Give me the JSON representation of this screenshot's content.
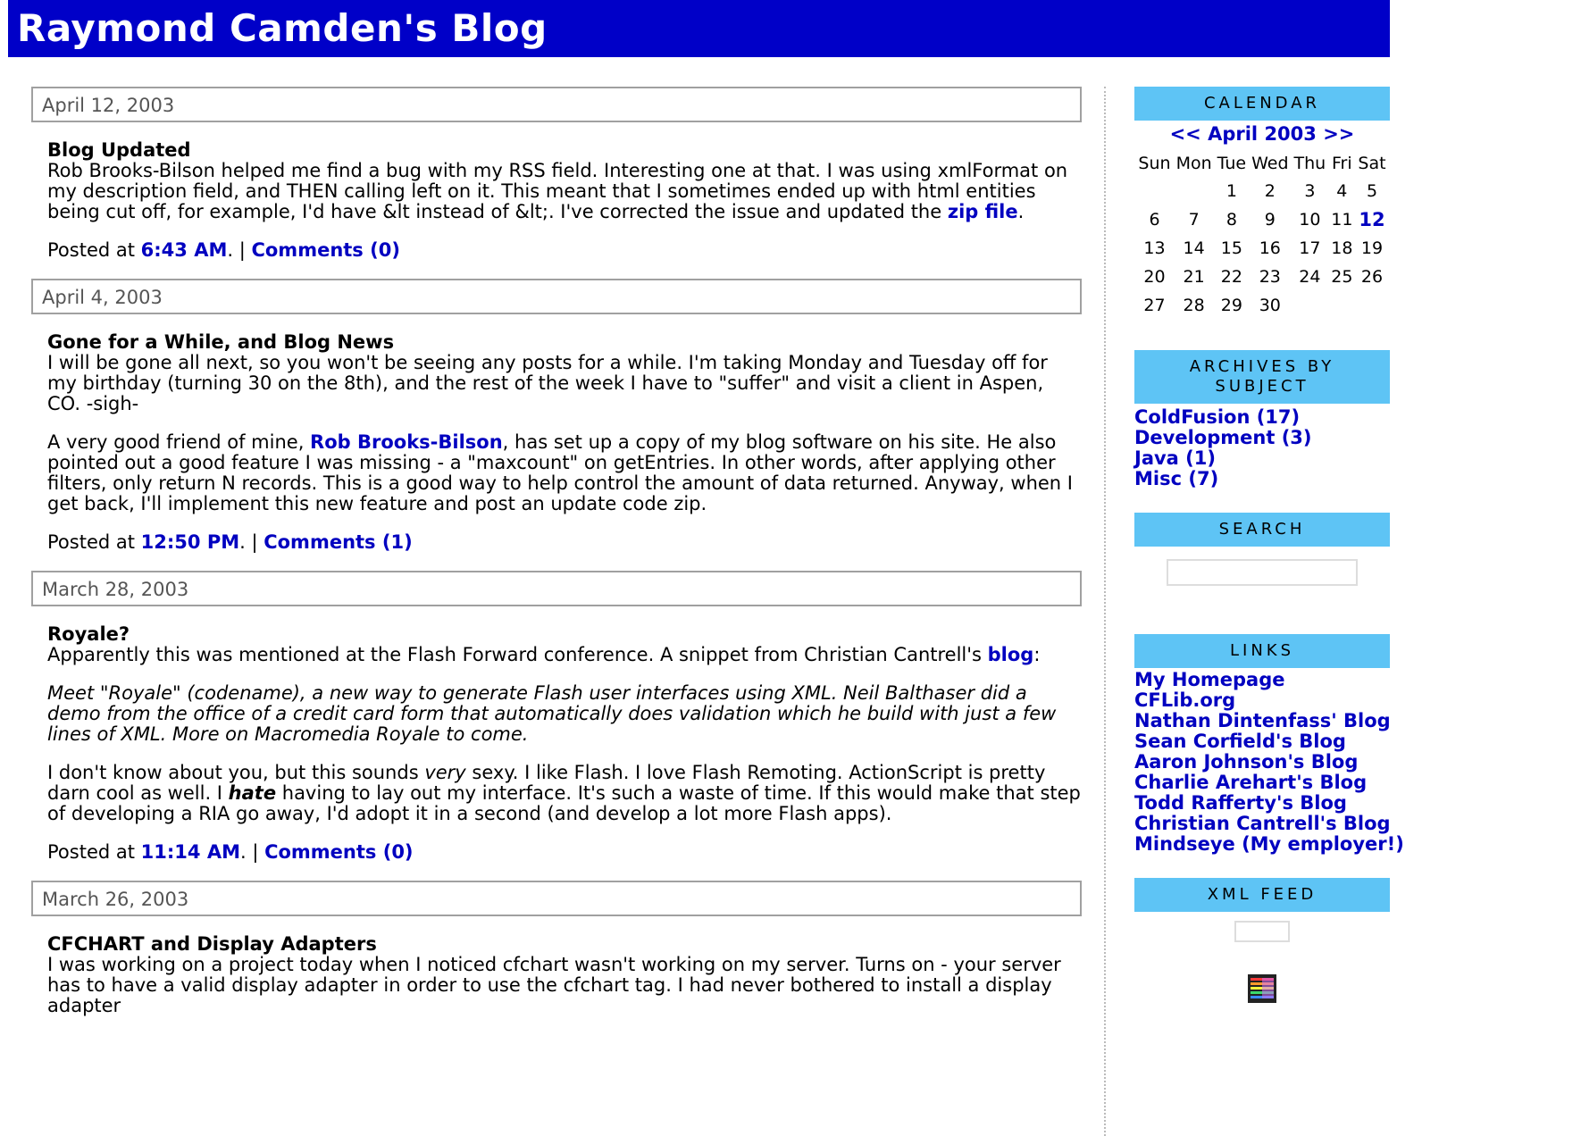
{
  "header": {
    "title": "Raymond Camden's Blog"
  },
  "entries": [
    {
      "date": "April 12, 2003",
      "title": "Blog Updated",
      "body": [
        {
          "segments": [
            {
              "text": "Rob Brooks-Bilson helped me find a bug with my RSS field. Interesting one at that. I was using xmlFormat on my description field, and THEN calling left on it. This meant that I sometimes ended up with html entities being cut off, for example, I'd have &lt instead of &lt;. I've corrected the issue and updated the "
            },
            {
              "text": "zip file",
              "link": true
            },
            {
              "text": "."
            }
          ]
        }
      ],
      "posted_prefix": "Posted at ",
      "time": "6:43 AM",
      "separator": ". | ",
      "comments": "Comments (0)"
    },
    {
      "date": "April 4, 2003",
      "title": "Gone for a While, and Blog News",
      "body": [
        {
          "segments": [
            {
              "text": "I will be gone all next, so you won't be seeing any posts for a while. I'm taking Monday and Tuesday off for my birthday (turning 30 on the 8th), and the rest of the week I have to \"suffer\" and visit a client in Aspen, CO. -sigh-"
            }
          ]
        },
        {
          "segments": [
            {
              "text": "A very good friend of mine, "
            },
            {
              "text": "Rob Brooks-Bilson",
              "link": true
            },
            {
              "text": ", has set up a copy of my blog software on his site. He also pointed out a good feature I was missing - a \"maxcount\" on getEntries. In other words, after applying other filters, only return N records. This is a good way to help control the amount of data returned. Anyway, when I get back, I'll implement this new feature and post an update code zip."
            }
          ]
        }
      ],
      "posted_prefix": "Posted at ",
      "time": "12:50 PM",
      "separator": ". | ",
      "comments": "Comments (1)"
    },
    {
      "date": "March 28, 2003",
      "title": "Royale?",
      "body": [
        {
          "segments": [
            {
              "text": "Apparently this was mentioned at the Flash Forward conference. A snippet from Christian Cantrell's "
            },
            {
              "text": "blog",
              "link": true
            },
            {
              "text": ":"
            }
          ]
        },
        {
          "italic": true,
          "segments": [
            {
              "text": "Meet \"Royale\" (codename), a new way to generate Flash user interfaces using XML. Neil Balthaser did a demo from the office of a credit card form that automatically does validation which he build with just a few lines of XML. More on Macromedia Royale to come."
            }
          ]
        },
        {
          "segments": [
            {
              "text": "I don't know about you, but this sounds "
            },
            {
              "text": "very",
              "italic": true
            },
            {
              "text": " sexy. I like Flash. I love Flash Remoting. ActionScript is pretty darn cool as well. I "
            },
            {
              "text": "hate",
              "bold": true,
              "italic": true
            },
            {
              "text": " having to lay out my interface. It's such a waste of time. If this would make that step of developing a RIA go away, I'd adopt it in a second (and develop a lot more Flash apps)."
            }
          ]
        }
      ],
      "posted_prefix": "Posted at ",
      "time": "11:14 AM",
      "separator": ". | ",
      "comments": "Comments (0)"
    },
    {
      "date": "March 26, 2003",
      "title": "CFCHART and Display Adapters",
      "body": [
        {
          "segments": [
            {
              "text": "I was working on a project today when I noticed cfchart wasn't working on my server. Turns on - your server has to have a valid display adapter in order to use the cfchart tag. I had never bothered to install a display adapter"
            }
          ]
        }
      ],
      "posted_prefix": "",
      "time": "",
      "separator": "",
      "comments": ""
    }
  ],
  "sidebar": {
    "calendar": {
      "heading": "CALENDAR",
      "prev": "<<",
      "month": "April 2003",
      "next": ">>",
      "days": [
        "Sun",
        "Mon",
        "Tue",
        "Wed",
        "Thu",
        "Fri",
        "Sat"
      ],
      "weeks": [
        [
          "",
          "",
          "1",
          "2",
          "3",
          "4",
          "5"
        ],
        [
          "6",
          "7",
          "8",
          "9",
          "10",
          "11",
          "12"
        ],
        [
          "13",
          "14",
          "15",
          "16",
          "17",
          "18",
          "19"
        ],
        [
          "20",
          "21",
          "22",
          "23",
          "24",
          "25",
          "26"
        ],
        [
          "27",
          "28",
          "29",
          "30",
          "",
          "",
          ""
        ]
      ],
      "linked_days": [
        "12"
      ]
    },
    "archives": {
      "heading": "ARCHIVES BY SUBJECT",
      "items": [
        "ColdFusion (17)",
        "Development (3)",
        "Java (1)",
        "Misc (7)"
      ]
    },
    "search": {
      "heading": "SEARCH",
      "value": ""
    },
    "links": {
      "heading": "LINKS",
      "items": [
        "My Homepage",
        "CFLib.org",
        "Nathan Dintenfass' Blog",
        "Sean Corfield's Blog",
        "Aaron Johnson's Blog",
        "Charlie Arehart's Blog",
        "Todd Rafferty's Blog",
        "Christian Cantrell's Blog",
        "Mindseye (My employer!)"
      ]
    },
    "xml_feed": {
      "heading": "XML FEED",
      "icon": "rss-feed-icon"
    }
  },
  "colors": {
    "header_bg": "#0000c8",
    "link": "#0000c0",
    "sidebar_heading_bg": "#5ec4f5",
    "date_border": "#a0a0a0"
  }
}
